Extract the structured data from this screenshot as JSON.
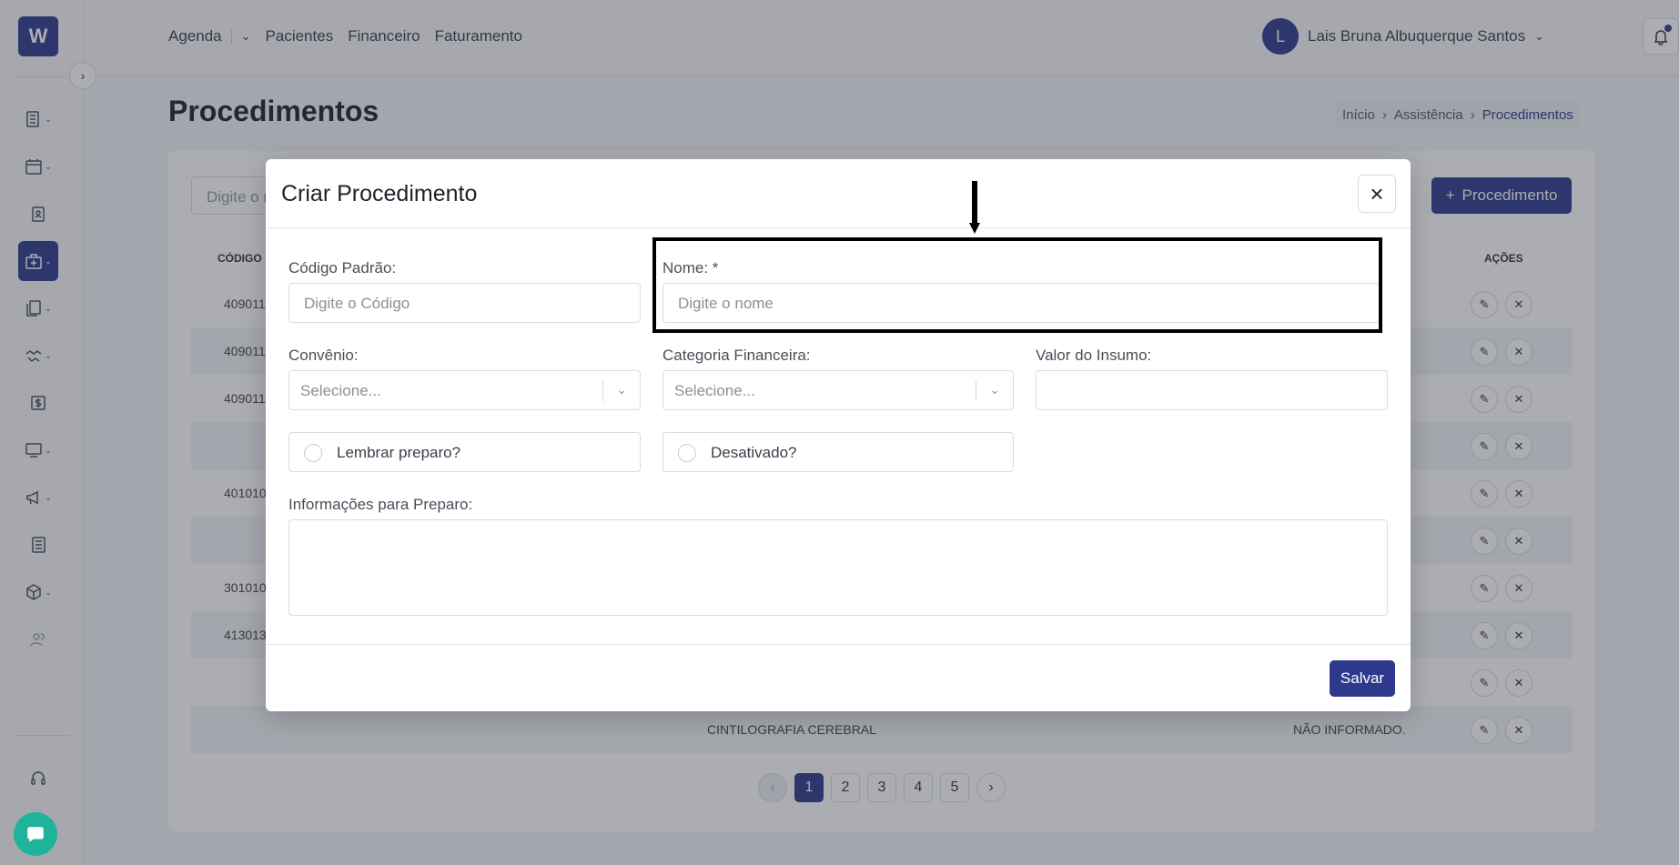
{
  "sidebar": {
    "logo": "W",
    "icons": [
      "list-icon",
      "calendar-icon",
      "clipboard-icon",
      "medical-kit-icon",
      "documents-icon",
      "handshake-icon",
      "dollar-icon",
      "monitor-icon",
      "megaphone-icon",
      "newspaper-icon",
      "box-icon",
      "users-icon",
      "headset-icon",
      "chat-icon"
    ]
  },
  "topnav": {
    "items": [
      "Agenda",
      "Pacientes",
      "Financeiro",
      "Faturamento"
    ]
  },
  "user": {
    "initial": "L",
    "name": "Lais Bruna Albuquerque Santos"
  },
  "page": {
    "title": "Procedimentos",
    "breadcrumb": [
      "Início",
      "Assistência",
      "Procedimentos"
    ],
    "search_placeholder": "Digite o n",
    "add_button": "Procedimento",
    "table_headers": {
      "code": "CÓDIGO",
      "actions": "AÇÕES"
    },
    "rows": [
      {
        "code": "409011",
        "name": "",
        "conv": ""
      },
      {
        "code": "409011",
        "name": "",
        "conv": ""
      },
      {
        "code": "409011",
        "name": "",
        "conv": ""
      },
      {
        "code": "",
        "name": "",
        "conv": ""
      },
      {
        "code": "401010",
        "name": "",
        "conv": ""
      },
      {
        "code": "",
        "name": "",
        "conv": ""
      },
      {
        "code": "301010",
        "name": "",
        "conv": ""
      },
      {
        "code": "413013",
        "name": "",
        "conv": ""
      },
      {
        "code": "",
        "name": "",
        "conv": ""
      },
      {
        "code": "",
        "name": "CINTILOGRAFIA CEREBRAL",
        "conv": "NÃO INFORMADO."
      }
    ],
    "pagination": [
      "1",
      "2",
      "3",
      "4",
      "5"
    ],
    "current_page": "1"
  },
  "modal": {
    "title": "Criar Procedimento",
    "close_label": "×",
    "fields": {
      "codigo_label": "Código Padrão:",
      "codigo_placeholder": "Digite o Código",
      "nome_label": "Nome: *",
      "nome_placeholder": "Digite o nome",
      "convenio_label": "Convênio:",
      "convenio_value": "Selecione...",
      "categoria_label": "Categoria Financeira:",
      "categoria_value": "Selecione...",
      "valor_label": "Valor do Insumo:",
      "valor_value": "",
      "lembrar_label": "Lembrar preparo?",
      "desativado_label": "Desativado?",
      "info_label": "Informações para Preparo:"
    },
    "save_button": "Salvar"
  }
}
